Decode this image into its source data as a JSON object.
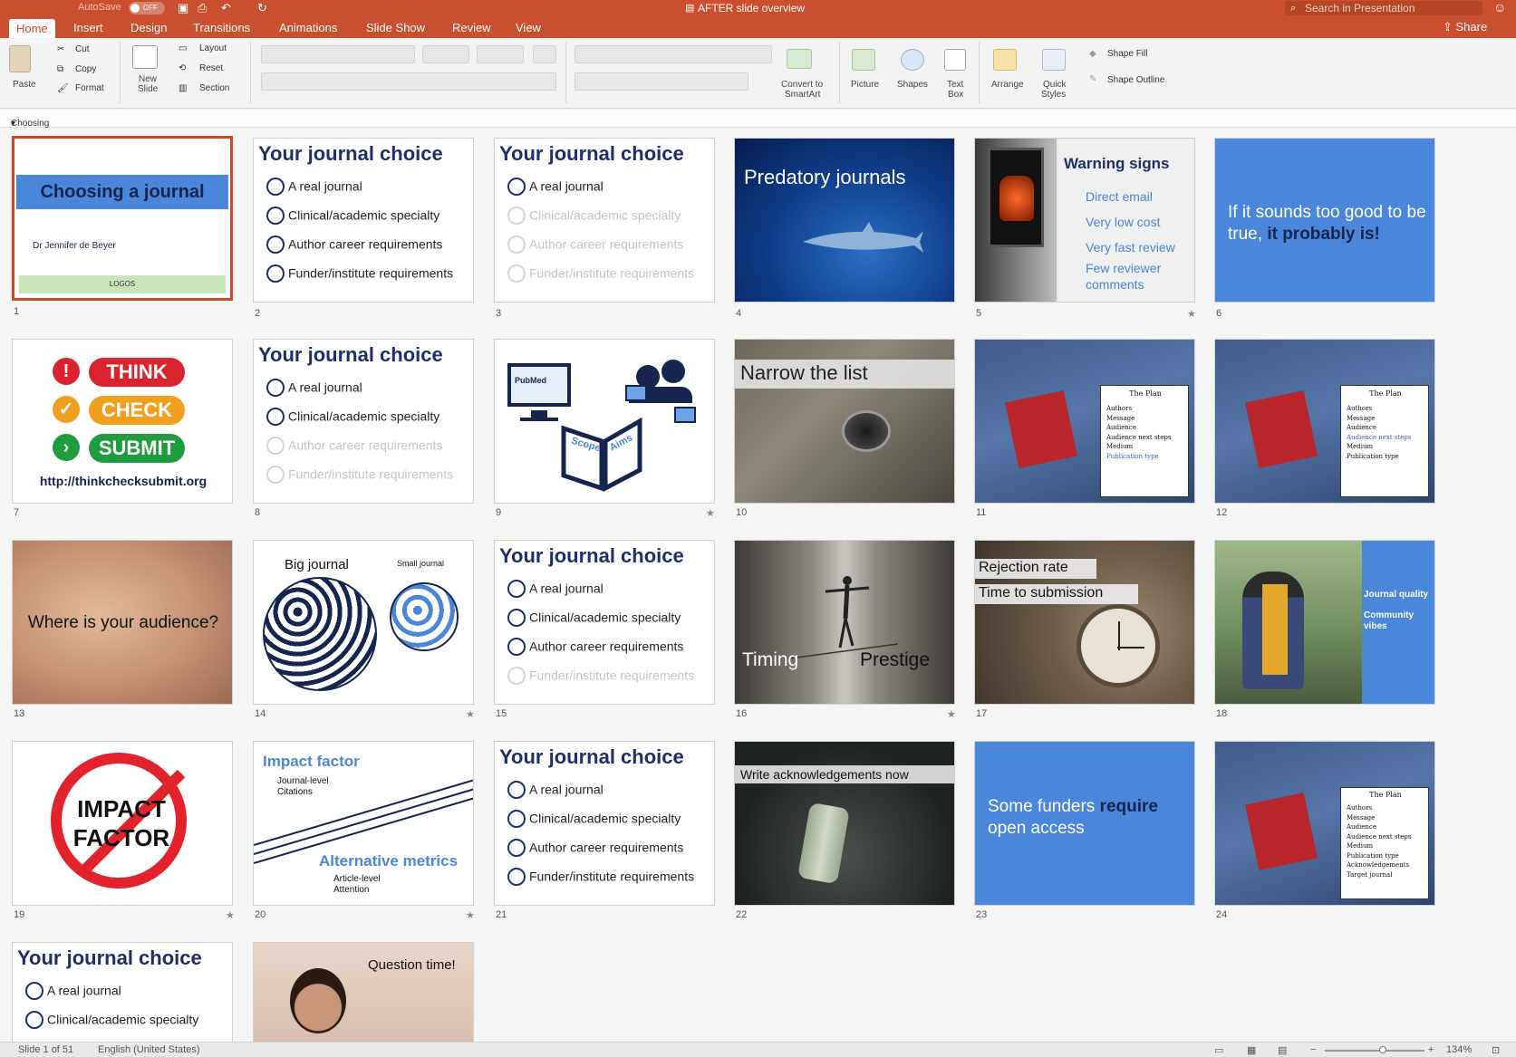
{
  "titlebar": {
    "autosave_label": "AutoSave",
    "autosave_state": "OFF",
    "window_title": "AFTER slide overview",
    "search_placeholder": "Search in Presentation"
  },
  "tabs": [
    "Home",
    "Insert",
    "Design",
    "Transitions",
    "Animations",
    "Slide Show",
    "Review",
    "View"
  ],
  "active_tab": "Home",
  "share_label": "Share",
  "ribbon": {
    "paste": "Paste",
    "cut": "Cut",
    "copy": "Copy",
    "format": "Format",
    "new_slide_1": "New",
    "new_slide_2": "Slide",
    "layout": "Layout",
    "reset": "Reset",
    "section": "Section",
    "convert_1": "Convert to",
    "convert_2": "SmartArt",
    "picture": "Picture",
    "shapes": "Shapes",
    "textbox_1": "Text",
    "textbox_2": "Box",
    "arrange": "Arrange",
    "quick_styles_1": "Quick",
    "quick_styles_2": "Styles",
    "shape_fill": "Shape Fill",
    "shape_outline": "Shape Outline"
  },
  "section_name": "Choosing a journal",
  "slides": {
    "s1": {
      "num": "1",
      "title": "Choosing a journal",
      "author": "Dr Jennifer de Beyer",
      "logos": "LOGOS"
    },
    "choice_title": "Your journal choice",
    "choice_items": [
      "A real journal",
      "Clinical/academic specialty",
      "Author career requirements",
      "Funder/institute requirements"
    ],
    "s4": {
      "num": "4",
      "title": "Predatory journals"
    },
    "s5": {
      "num": "5",
      "title": "Warning signs",
      "items": [
        "Direct email",
        "Very low cost",
        "Very fast review",
        "Few reviewer comments"
      ]
    },
    "s6": {
      "num": "6",
      "text_plain": "If it sounds too good to be true, ",
      "text_bold": "it probably is!"
    },
    "s7": {
      "num": "7",
      "think": "THINK",
      "check": "CHECK",
      "submit": "SUBMIT",
      "url": "http://thinkchecksubmit.org"
    },
    "s9": {
      "num": "9",
      "pubmed": "PubMed",
      "scope": "Scope",
      "aims": "Aims"
    },
    "s10": {
      "num": "10",
      "title": "Narrow the list"
    },
    "plan_title": "The Plan",
    "plan_items_short": [
      "Authors",
      "Message",
      "Audience",
      "Audience next steps",
      "Medium",
      "Publication type"
    ],
    "plan_items_long": [
      "Authors",
      "Message",
      "Audience",
      "Audience next steps",
      "Medium",
      "Publication type",
      "Acknowledgements",
      "Target journal"
    ],
    "s13": {
      "num": "13",
      "title": "Where is your audience?"
    },
    "s14": {
      "num": "14",
      "big": "Big journal",
      "small": "Small journal"
    },
    "s16": {
      "num": "16",
      "left": "Timing",
      "right": "Prestige"
    },
    "s17": {
      "num": "17",
      "line1": "Rejection rate",
      "line2": "Time to submission"
    },
    "s18": {
      "num": "18",
      "line1": "Journal quality",
      "line2": "Community vibes"
    },
    "s19": {
      "num": "19",
      "line1": "IMPACT",
      "line2": "FACTOR"
    },
    "s20": {
      "num": "20",
      "title1": "Impact factor",
      "sub1a": "Journal-level",
      "sub1b": "Citations",
      "title2": "Alternative metrics",
      "sub2a": "Article-level",
      "sub2b": "Attention"
    },
    "s22": {
      "num": "22",
      "title": "Write acknowledgements now"
    },
    "s23": {
      "num": "23",
      "text_plain_1": "Some funders ",
      "text_bold": "require",
      "text_plain_2": "open access"
    },
    "s26": {
      "title": "Question time!"
    },
    "nums": {
      "n2": "2",
      "n3": "3",
      "n8": "8",
      "n11": "11",
      "n12": "12",
      "n15": "15",
      "n21": "21",
      "n24": "24"
    }
  },
  "status": {
    "slide_count": "Slide 1 of 51",
    "language": "English (United States)",
    "zoom": "134%"
  },
  "colors": {
    "accent": "#c94f2e",
    "navy": "#1e2f6b",
    "slide_blue": "#4a86d9"
  }
}
